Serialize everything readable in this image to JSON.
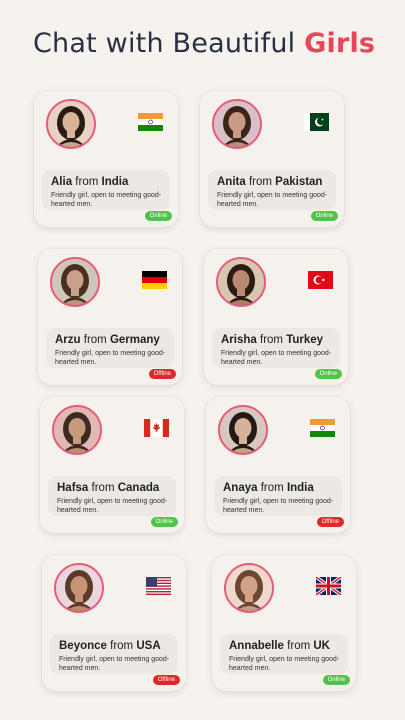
{
  "header": {
    "title_prefix": "Chat with Beautiful",
    "title_accent": "Girls",
    "accent_color": "#e8455a"
  },
  "from_word": "from",
  "profiles": [
    {
      "name": "Alia",
      "country": "India",
      "flag": "india-flag-icon",
      "desc": "Friendly girl, open to meeting good-hearted men.",
      "status": "Online"
    },
    {
      "name": "Anita",
      "country": "Pakistan",
      "flag": "pakistan-flag-icon",
      "desc": "Friendly girl, open to meeting good-hearted men.",
      "status": "Online"
    },
    {
      "name": "Arzu",
      "country": "Germany",
      "flag": "germany-flag-icon",
      "desc": "Friendly girl, open to meeting good-hearted men.",
      "status": "Offline"
    },
    {
      "name": "Arisha",
      "country": "Turkey",
      "flag": "turkey-flag-icon",
      "desc": "Friendly girl, open to meeting good-hearted men.",
      "status": "Online"
    },
    {
      "name": "Hafsa",
      "country": "Canada",
      "flag": "canada-flag-icon",
      "desc": "Friendly girl, open to meeting good-hearted men.",
      "status": "Online"
    },
    {
      "name": "Anaya",
      "country": "India",
      "flag": "india-flag-icon",
      "desc": "Friendly girl, open to meeting good-hearted men.",
      "status": "Offline"
    },
    {
      "name": "Beyonce",
      "country": "USA",
      "flag": "usa-flag-icon",
      "desc": "Friendly girl, open to meeting good-hearted men.",
      "status": "Offline"
    },
    {
      "name": "Annabelle",
      "country": "UK",
      "flag": "uk-flag-icon",
      "desc": "Friendly girl, open to meeting good-hearted men.",
      "status": "Online"
    }
  ],
  "colors": {
    "online": "#53c24a",
    "offline": "#e02828",
    "avatar_ring": "#e85a7a"
  }
}
